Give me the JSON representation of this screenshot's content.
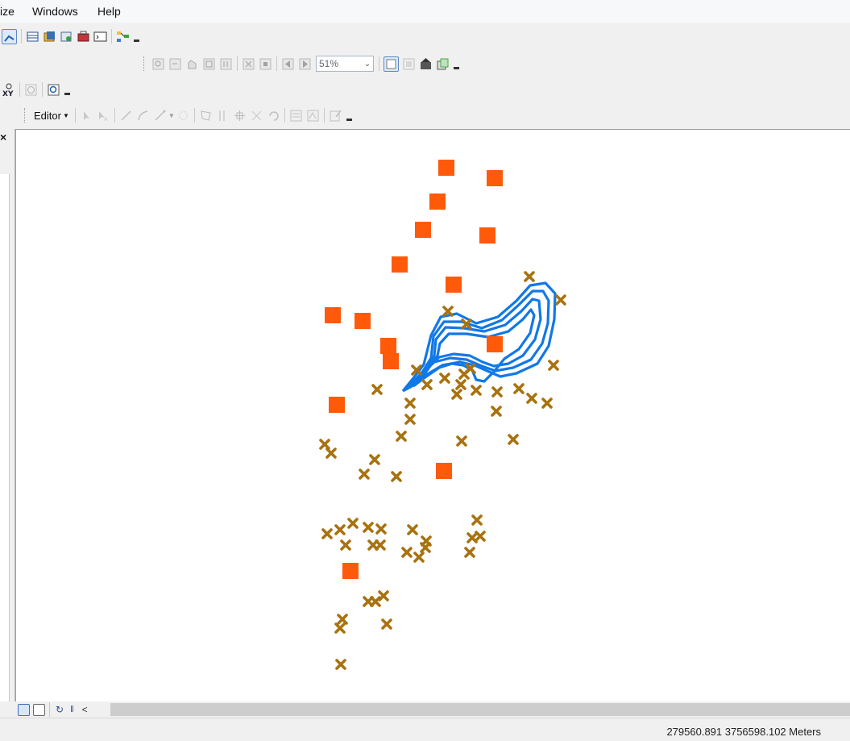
{
  "menu": {
    "items": [
      "ize",
      "Windows",
      "Help"
    ]
  },
  "toolbar_layout": {
    "zoom_value": "51%"
  },
  "editor_toolbar": {
    "editor_label": "Editor"
  },
  "left_panel": {
    "close_glyph": "×"
  },
  "map": {
    "colors": {
      "square": "#ff5a0a",
      "cross": "#a8720f",
      "polygon": "#1078e8"
    },
    "legend": "none"
  },
  "status_bar": {
    "coordinates": "279560.891  3756598.102 Meters"
  },
  "icons": [
    "select-features-icon",
    "identify-icon",
    "table-icon",
    "catalog-icon",
    "search-icon",
    "toolbox-icon",
    "python-icon",
    "model-builder-icon",
    "xy-icon",
    "clock-icon",
    "find-icon",
    "zoom-in-page-icon",
    "zoom-out-page-icon",
    "pan-page-icon",
    "full-page-icon",
    "zoom-100-icon",
    "fixed-zoom-in-icon",
    "fixed-zoom-out-icon",
    "back-extent-icon",
    "forward-extent-icon",
    "toggle-draft-icon",
    "focus-data-frame-icon",
    "change-layout-icon",
    "data-driven-pages-icon",
    "edit-tool-icon",
    "annotation-edit-icon",
    "straight-segment-icon",
    "end-point-arc-icon",
    "trace-icon",
    "point-icon",
    "edit-vertices-icon",
    "reshape-icon",
    "cut-polygon-icon",
    "split-icon",
    "rotate-icon",
    "attributes-icon",
    "sketch-properties-icon",
    "create-features-icon",
    "layout-view-icon",
    "data-view-icon",
    "refresh-icon",
    "pause-icon",
    "scroll-left-icon"
  ]
}
